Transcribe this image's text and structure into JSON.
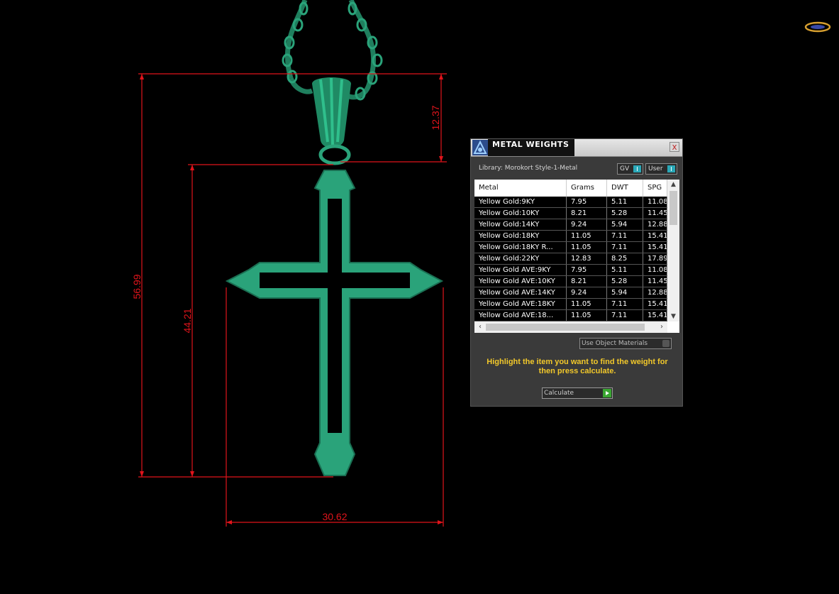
{
  "dimensions": {
    "total_height": "56.99",
    "cross_height": "44.21",
    "bail_height": "12.37",
    "width": "30.62"
  },
  "colors": {
    "dimension_lines": "#e0141b",
    "pendant": "#2aa37a",
    "hint_text": "#f2c82a"
  },
  "icons": {
    "top_right_logo": "ring-logo-icon",
    "app_logo": "app-logo-icon"
  },
  "panel": {
    "title": "METAL WEIGHTS",
    "close_label": "x",
    "library_label": "Library: Morokort Style-1-Metal",
    "toggle_gv_label": "GV",
    "toggle_user_label": "User",
    "columns": [
      "Metal",
      "Grams",
      "DWT",
      "SPG"
    ],
    "rows": [
      [
        "Yellow Gold:9KY",
        "7.95",
        "5.11",
        "11.08"
      ],
      [
        "Yellow Gold:10KY",
        "8.21",
        "5.28",
        "11.45"
      ],
      [
        "Yellow Gold:14KY",
        "9.24",
        "5.94",
        "12.88"
      ],
      [
        "Yellow Gold:18KY",
        "11.05",
        "7.11",
        "15.41"
      ],
      [
        "Yellow Gold:18KY R...",
        "11.05",
        "7.11",
        "15.41"
      ],
      [
        "Yellow Gold:22KY",
        "12.83",
        "8.25",
        "17.89"
      ],
      [
        "Yellow Gold AVE:9KY",
        "7.95",
        "5.11",
        "11.08"
      ],
      [
        "Yellow Gold AVE:10KY",
        "8.21",
        "5.28",
        "11.45"
      ],
      [
        "Yellow Gold AVE:14KY",
        "9.24",
        "5.94",
        "12.88"
      ],
      [
        "Yellow Gold AVE:18KY",
        "11.05",
        "7.11",
        "15.41"
      ],
      [
        "Yellow Gold AVE:18...",
        "11.05",
        "7.11",
        "15.41"
      ]
    ],
    "use_object_materials_label": "Use Object Materials",
    "hint": "Highlight the item you want to find the weight for then press calculate.",
    "calculate_label": "Calculate"
  }
}
